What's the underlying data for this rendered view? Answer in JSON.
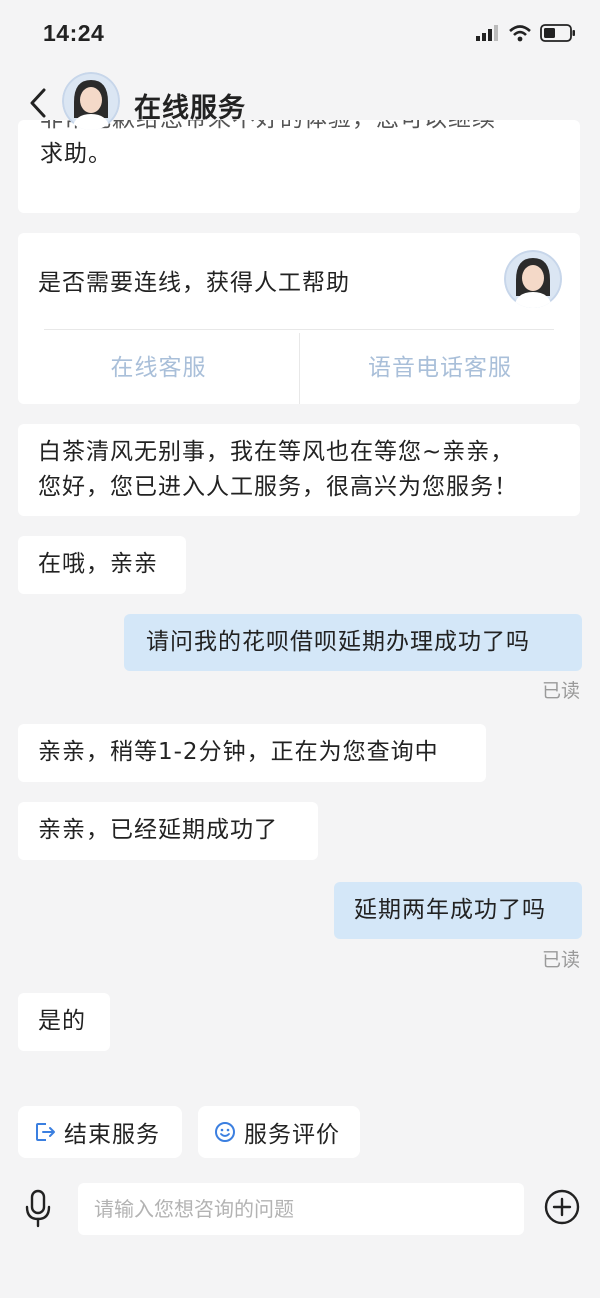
{
  "status_bar": {
    "time": "14:24"
  },
  "header": {
    "title": "在线服务"
  },
  "messages": {
    "prev_clipped_line": "非常抱歉给您带来不好的体验，您可以继续",
    "prev_last_line": "求助。",
    "transfer_prompt": "是否需要连线，获得人工帮助",
    "transfer_option_online": "在线客服",
    "transfer_option_phone": "语音电话客服",
    "agent_greeting_line1": "白茶清风无别事，我在等风也在等您~亲亲，",
    "agent_greeting_line2": "您好，您已进入人工服务，很高兴为您服务！",
    "agent_here": "在哦，亲亲",
    "user_question_1": "请问我的花呗借呗延期办理成功了吗",
    "read_receipt": "已读",
    "agent_wait": "亲亲，稍等1-2分钟，正在为您查询中",
    "agent_success": "亲亲，已经延期成功了",
    "user_question_2": "延期两年成功了吗",
    "agent_yes": "是的"
  },
  "quick_actions": {
    "end_service": "结束服务",
    "rate_service": "服务评价"
  },
  "composer": {
    "placeholder": "请输入您想咨询的问题",
    "value": ""
  },
  "colors": {
    "accent_blue": "#3b7fe0",
    "user_bubble": "#d4e7f8",
    "option_text": "#a9bfd9",
    "background": "#f4f4f5"
  }
}
